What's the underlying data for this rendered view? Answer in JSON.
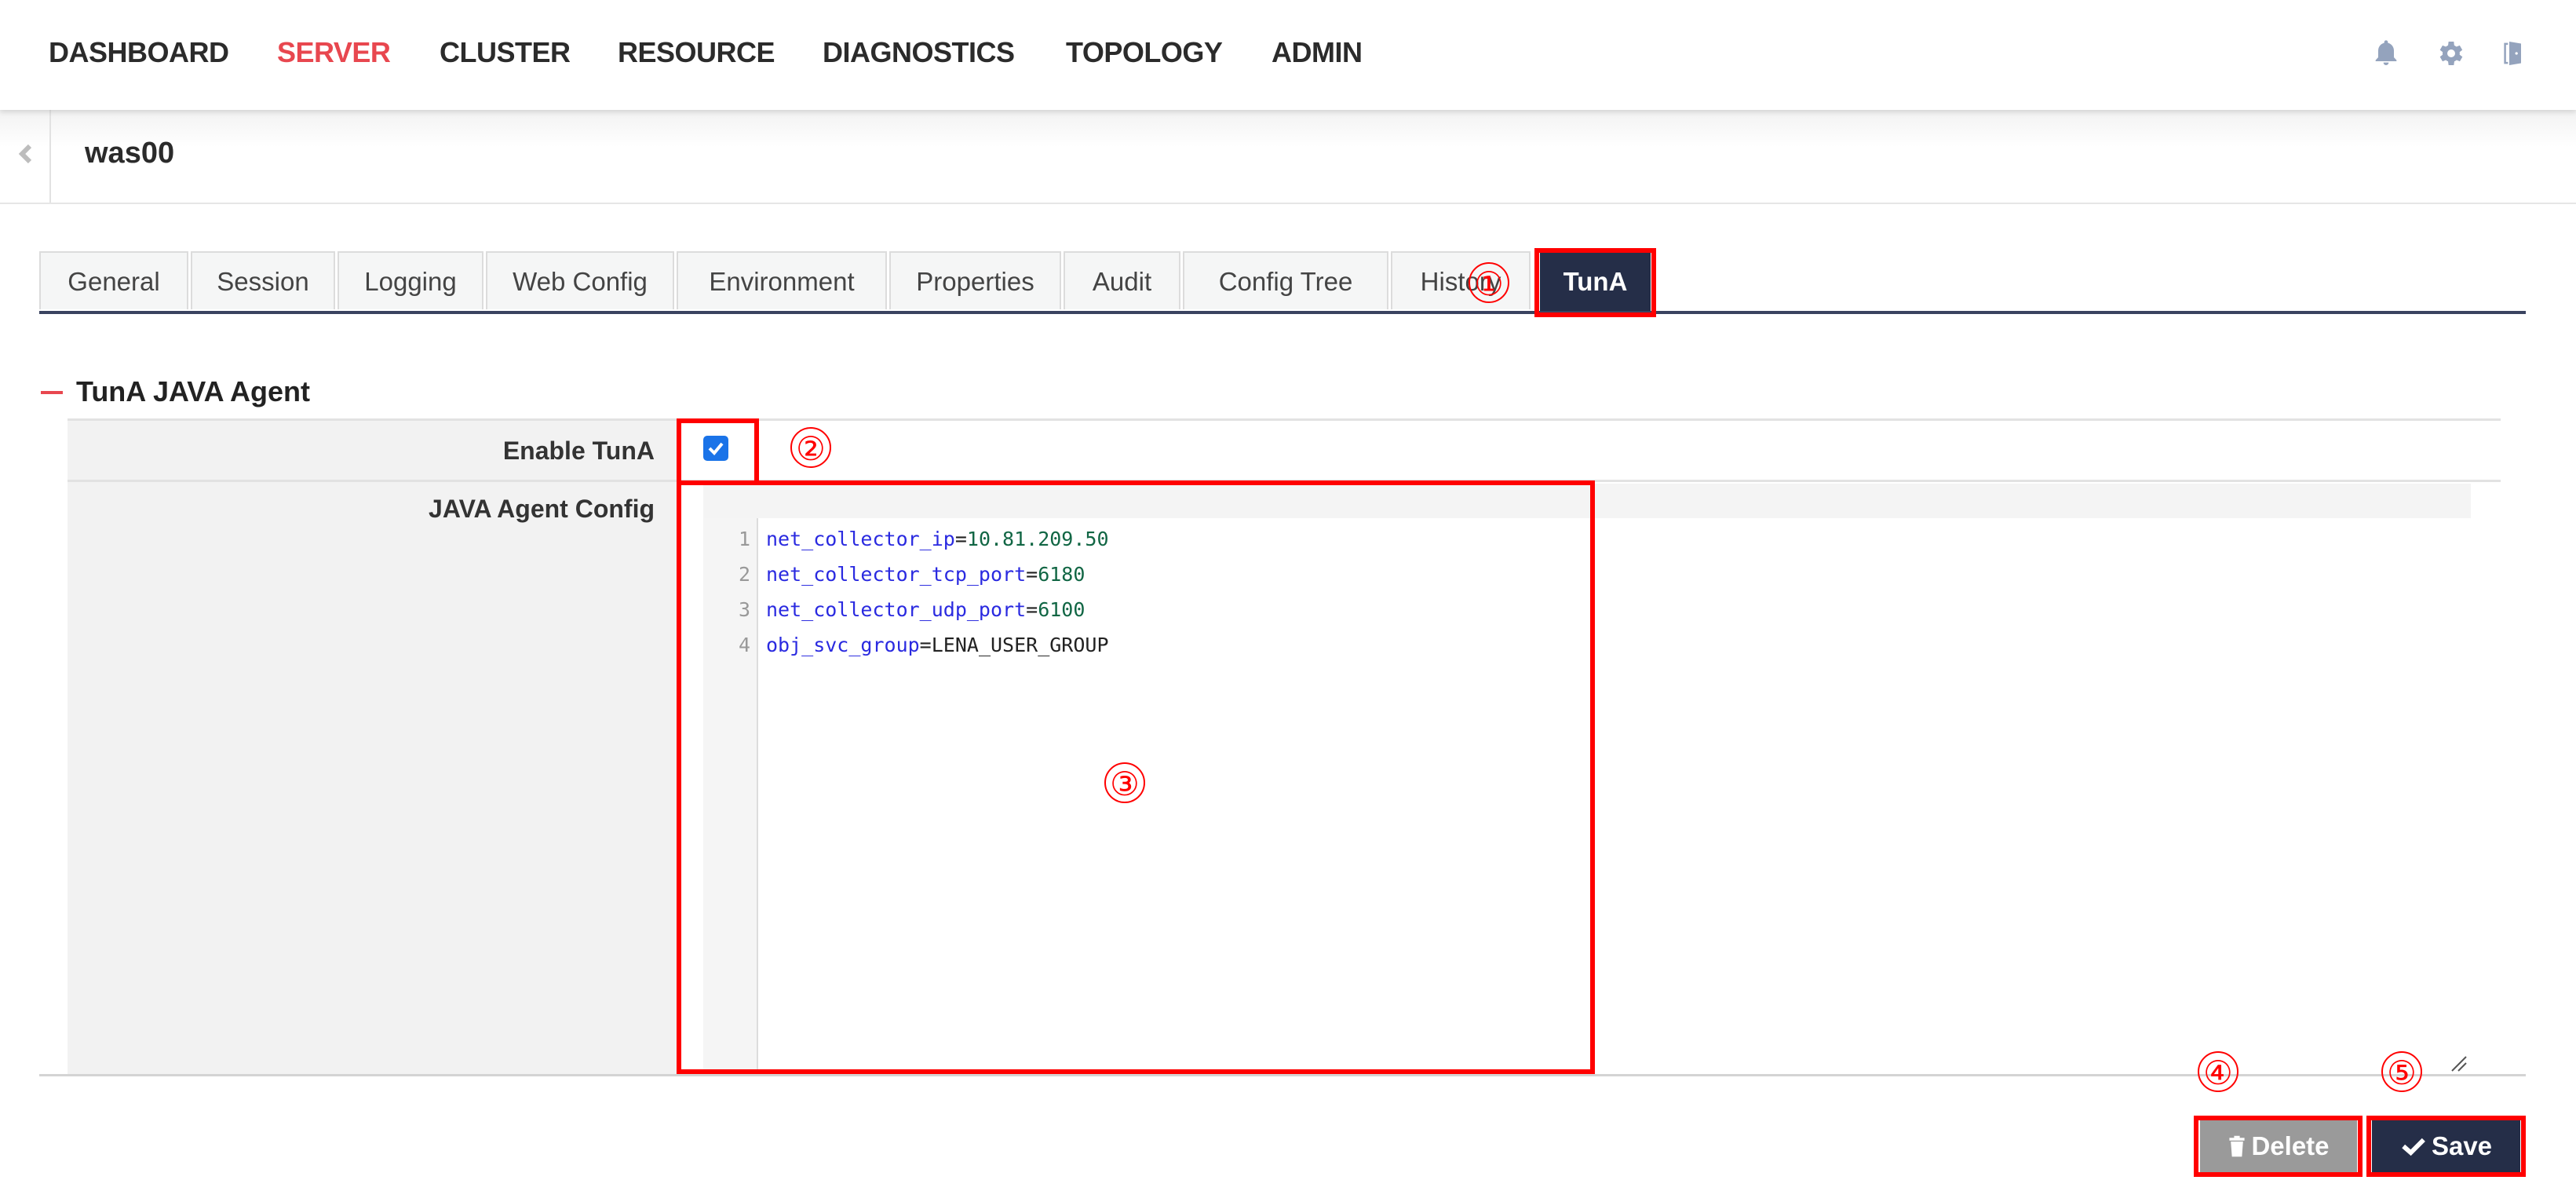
{
  "nav": {
    "items": [
      {
        "label": "DASHBOARD",
        "active": false
      },
      {
        "label": "SERVER",
        "active": true
      },
      {
        "label": "CLUSTER",
        "active": false
      },
      {
        "label": "RESOURCE",
        "active": false
      },
      {
        "label": "DIAGNOSTICS",
        "active": false
      },
      {
        "label": "TOPOLOGY",
        "active": false
      },
      {
        "label": "ADMIN",
        "active": false
      }
    ],
    "icons": [
      "bell-icon",
      "gear-icon",
      "logout-door-icon"
    ],
    "accent_color": "#e8474f"
  },
  "breadcrumb": {
    "back_icon": "chevron-left-icon",
    "title": "was00"
  },
  "tabs": [
    {
      "label": "General"
    },
    {
      "label": "Session"
    },
    {
      "label": "Logging"
    },
    {
      "label": "Web Config"
    },
    {
      "label": "Environment"
    },
    {
      "label": "Properties"
    },
    {
      "label": "Audit"
    },
    {
      "label": "Config Tree"
    },
    {
      "label": "History"
    },
    {
      "label": "TunA",
      "active": true
    }
  ],
  "section": {
    "title": "TunA JAVA Agent",
    "collapse_icon": "minus-icon"
  },
  "form": {
    "enable_label": "Enable TunA",
    "enable_checked": true,
    "config_label": "JAVA Agent Config",
    "config_lines": [
      {
        "no": "1",
        "key": "net_collector_ip",
        "eq": "=",
        "value": "10.81.209.50",
        "value_type": "num"
      },
      {
        "no": "2",
        "key": "net_collector_tcp_port",
        "eq": "=",
        "value": "6180",
        "value_type": "num"
      },
      {
        "no": "3",
        "key": "net_collector_udp_port",
        "eq": "=",
        "value": "6100",
        "value_type": "num"
      },
      {
        "no": "4",
        "key": "obj_svc_group",
        "eq": "=",
        "value": "LENA_USER_GROUP",
        "value_type": "txt"
      }
    ]
  },
  "buttons": {
    "delete_label": "Delete",
    "save_label": "Save"
  },
  "annotations": [
    "①",
    "②",
    "③",
    "④",
    "⑤"
  ],
  "colors": {
    "primary_dark": "#252e48",
    "checkbox": "#1a73e8",
    "annotation": "#ff0000",
    "delete_button": "#9a9a9a"
  }
}
